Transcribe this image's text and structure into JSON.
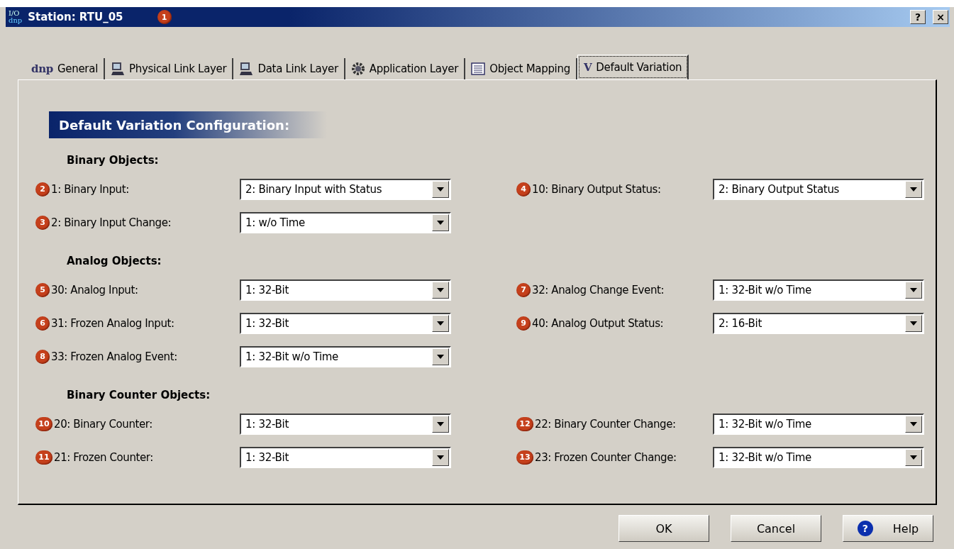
{
  "window": {
    "icon_lines": [
      "I/O",
      "dnp"
    ],
    "title": "Station: RTU_05",
    "badge": "1",
    "controls": [
      "?",
      "×"
    ]
  },
  "tabs": [
    {
      "label": "General",
      "kind": "glyph",
      "glyph": "dnp",
      "selected": false
    },
    {
      "label": "Physical Link Layer",
      "kind": "monitor",
      "selected": false
    },
    {
      "label": "Data Link Layer",
      "kind": "monitor",
      "selected": false
    },
    {
      "label": "Application Layer",
      "kind": "gear",
      "selected": false
    },
    {
      "label": "Object Mapping",
      "kind": "list",
      "selected": false
    },
    {
      "label": "Default Variation",
      "kind": "glyph",
      "glyph": "V",
      "selected": true
    }
  ],
  "panel": {
    "header": "Default Variation Configuration:",
    "sections": [
      {
        "title": "Binary Objects:",
        "rows": [
          {
            "left": {
              "badge": "2",
              "label": "1: Binary Input:",
              "value": "2: Binary Input with Status"
            },
            "right": {
              "badge": "4",
              "label": "10: Binary Output Status:",
              "value": "2: Binary Output Status"
            }
          },
          {
            "left": {
              "badge": "3",
              "label": "2: Binary Input Change:",
              "value": "1: w/o Time"
            }
          }
        ]
      },
      {
        "title": "Analog Objects:",
        "rows": [
          {
            "left": {
              "badge": "5",
              "label": "30: Analog Input:",
              "value": "1: 32-Bit"
            },
            "right": {
              "badge": "7",
              "label": "32: Analog Change Event:",
              "value": "1: 32-Bit w/o Time"
            }
          },
          {
            "left": {
              "badge": "6",
              "label": "31: Frozen Analog Input:",
              "value": "1: 32-Bit"
            },
            "right": {
              "badge": "9",
              "label": "40: Analog Output Status:",
              "value": "2: 16-Bit"
            }
          },
          {
            "left": {
              "badge": "8",
              "label": "33: Frozen Analog Event:",
              "value": "1: 32-Bit w/o Time"
            }
          }
        ]
      },
      {
        "title": "Binary Counter Objects:",
        "rows": [
          {
            "left": {
              "badge": "10",
              "label": "20: Binary Counter:",
              "value": "1: 32-Bit"
            },
            "right": {
              "badge": "12",
              "label": "22: Binary Counter Change:",
              "value": "1: 32-Bit w/o Time"
            }
          },
          {
            "left": {
              "badge": "11",
              "label": "21: Frozen Counter:",
              "value": "1: 32-Bit"
            },
            "right": {
              "badge": "13",
              "label": "23: Frozen Counter Change:",
              "value": "1: 32-Bit w/o Time"
            }
          }
        ]
      }
    ]
  },
  "buttons": [
    {
      "label": "OK"
    },
    {
      "label": "Cancel"
    },
    {
      "label": "Help",
      "icon": "?"
    }
  ]
}
